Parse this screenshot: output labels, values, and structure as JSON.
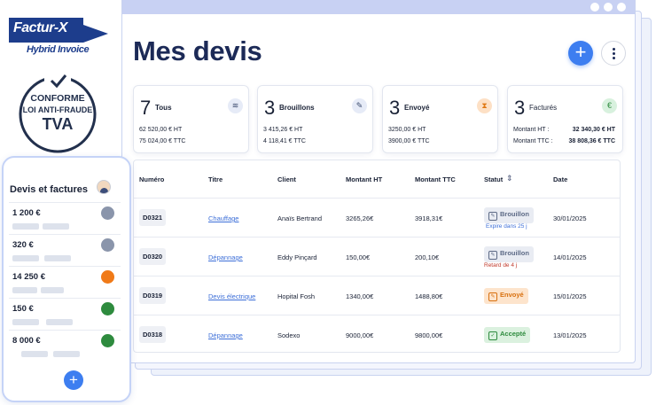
{
  "branding": {
    "facturx_title": "Factur-X",
    "facturx_subtitle": "Hybrid Invoice",
    "seal_lines": [
      "CONFORME",
      "LOI ANTI-FRAUDE",
      "TVA"
    ]
  },
  "header": {
    "title": "Mes devis",
    "add_icon": "+",
    "more_icon": "more-vertical"
  },
  "stats": [
    {
      "count": "7",
      "label": "Tous",
      "icon": "layers-icon",
      "icon_color": "#e6ebf7",
      "lines": [
        [
          "62 520,00 € HT",
          ""
        ],
        [
          "75 024,00 € TTC",
          ""
        ]
      ]
    },
    {
      "count": "3",
      "label": "Brouillons",
      "icon": "edit-icon",
      "icon_color": "#e6ebf7",
      "lines": [
        [
          "3 415,26 € HT",
          ""
        ],
        [
          "4 118,41 € TTC",
          ""
        ]
      ]
    },
    {
      "count": "3",
      "label": "Envoyé",
      "icon": "hourglass-icon",
      "icon_color": "#fde0c5",
      "lines": [
        [
          "3250,00 € HT",
          ""
        ],
        [
          "3900,00 € TTC",
          ""
        ]
      ]
    },
    {
      "count": "3",
      "label": "Facturés",
      "icon": "euro-icon",
      "icon_color": "#d8f1de",
      "lines": [
        [
          "Montant HT :",
          "32 340,30 € HT"
        ],
        [
          "Montant TTC :",
          "38 808,36 € TTC"
        ]
      ]
    }
  ],
  "table": {
    "headers": [
      "Numéro",
      "Titre",
      "Client",
      "Montant HT",
      "Montant TTC",
      "Statut",
      "Date"
    ],
    "rows": [
      {
        "num": "D0321",
        "title": "Chauffage",
        "client": "Anaïs Bertrand",
        "ht": "3265,26€",
        "ttc": "3918,31€",
        "status": "Brouillon",
        "status_kind": "draft",
        "sub": "Expire dans 25 j",
        "sub_color": "#3d6fd8",
        "date": "30/01/2025"
      },
      {
        "num": "D0320",
        "title": "Dépannage",
        "client": "Eddy Pinçard",
        "ht": "150,00€",
        "ttc": "200,10€",
        "status": "Brouillon",
        "status_kind": "draft",
        "sub": "Retard de 4 j",
        "sub_color": "#c0392b",
        "date": "14/01/2025"
      },
      {
        "num": "D0319",
        "title": "Devis électrique",
        "client": "Hopital Fosh",
        "ht": "1340,00€",
        "ttc": "1488,80€",
        "status": "Envoyé",
        "status_kind": "sent",
        "sub": "",
        "sub_color": "",
        "date": "15/01/2025"
      },
      {
        "num": "D0318",
        "title": "Dépannage",
        "client": "Sodexo",
        "ht": "9000,00€",
        "ttc": "9800,00€",
        "status": "Accepté",
        "status_kind": "accepted",
        "sub": "",
        "sub_color": "",
        "date": "13/01/2025"
      }
    ]
  },
  "phone": {
    "title": "Devis et factures",
    "items": [
      {
        "amount": "1 200 €",
        "dot_color": "#8a95ab"
      },
      {
        "amount": "320 €",
        "dot_color": "#8a95ab"
      },
      {
        "amount": "14 250 €",
        "dot_color": "#f07a18"
      },
      {
        "amount": "150 €",
        "dot_color": "#2e8b3e"
      },
      {
        "amount": "8 000 €",
        "dot_color": "#2e8b3e"
      }
    ],
    "add_icon": "+"
  },
  "colors": {
    "accent": "#3d7ef0",
    "navy": "#1c2a57",
    "brand": "#1d3d8c"
  }
}
